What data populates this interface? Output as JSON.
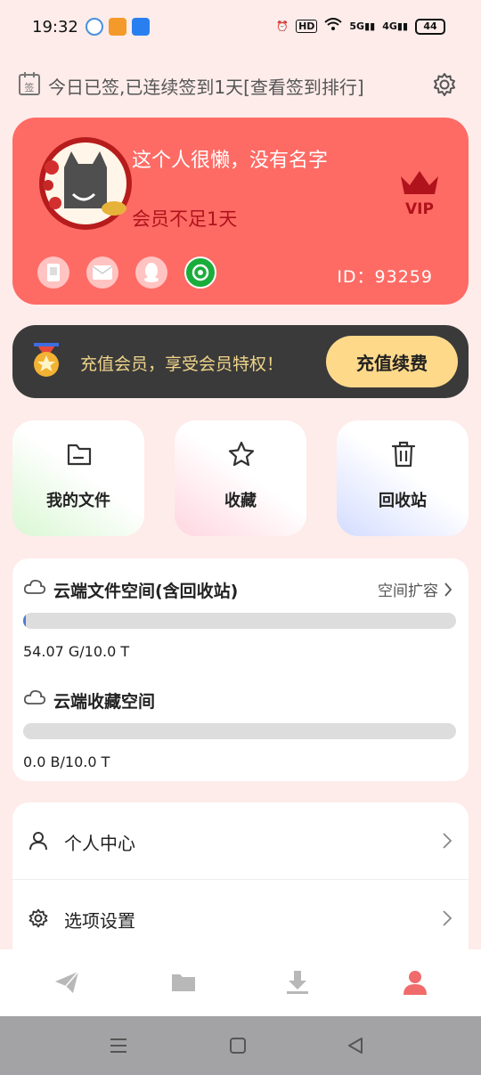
{
  "status_bar": {
    "time": "19:32",
    "network_labels": [
      "HD",
      "5G",
      "4G"
    ],
    "battery": "44"
  },
  "signin": {
    "text": "今日已签,已连续签到1天[查看签到排行]",
    "calendar_label": "签"
  },
  "profile": {
    "username": "这个人很懒，没有名字",
    "member_status": "会员不足1天",
    "vip_label": "VIP",
    "user_id": "ID：93259",
    "colors": {
      "card": "#fe6b65",
      "status": "#b0131b"
    },
    "social_icons": [
      "phone-icon",
      "mail-icon",
      "qq-icon",
      "wechat-icon"
    ]
  },
  "recharge": {
    "text": "充值会员，享受会员特权！",
    "button": "充值续费"
  },
  "tiles": [
    {
      "label": "我的文件",
      "icon": "folder-icon"
    },
    {
      "label": "收藏",
      "icon": "star-icon"
    },
    {
      "label": "回收站",
      "icon": "trash-icon"
    }
  ],
  "storage": {
    "cloud": {
      "title": "云端文件空间(含回收站)",
      "expand_label": "空间扩容",
      "usage": "54.07 G/10.0 T",
      "fraction": 0.005
    },
    "favorites": {
      "title": "云端收藏空间",
      "usage": "0.0 B/10.0 T",
      "fraction": 0
    }
  },
  "menu": [
    {
      "label": "个人中心",
      "icon": "user-icon"
    },
    {
      "label": "选项设置",
      "icon": "gear-icon"
    }
  ],
  "bottom_nav": {
    "items": [
      "send-icon",
      "folder-icon",
      "download-icon",
      "profile-icon"
    ],
    "active": "profile-icon",
    "active_color": "#f06b6b"
  },
  "system_nav": [
    "recent-apps-icon",
    "home-icon",
    "back-icon"
  ]
}
